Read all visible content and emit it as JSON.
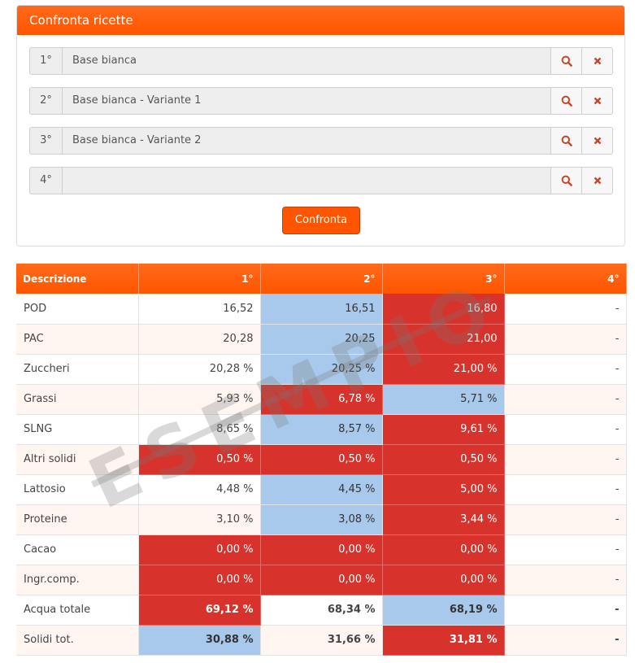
{
  "panel": {
    "title": "Confronta ricette"
  },
  "recipes": [
    {
      "ord": "1°",
      "value": "Base bianca"
    },
    {
      "ord": "2°",
      "value": "Base bianca - Variante 1"
    },
    {
      "ord": "3°",
      "value": "Base bianca - Variante 2"
    },
    {
      "ord": "4°",
      "value": ""
    }
  ],
  "icons": {
    "search": "search-icon",
    "remove": "close-icon"
  },
  "compare_button": "Confronta",
  "table": {
    "headers": [
      "Descrizione",
      "1°",
      "2°",
      "3°",
      "4°"
    ],
    "rows": [
      {
        "label": "POD",
        "c1": "16,52",
        "c2": "16,51",
        "c3": "16,80",
        "c4": "-"
      },
      {
        "label": "PAC",
        "c1": "20,28",
        "c2": "20,25",
        "c3": "21,00",
        "c4": "-"
      },
      {
        "label": "Zuccheri",
        "c1": "20,28 %",
        "c2": "20,25 %",
        "c3": "21,00 %",
        "c4": "-"
      },
      {
        "label": "Grassi",
        "c1": "5,93 %",
        "c2": "6,78 %",
        "c3": "5,71 %",
        "c4": "-"
      },
      {
        "label": "SLNG",
        "c1": "8,65 %",
        "c2": "8,57 %",
        "c3": "9,61 %",
        "c4": "-"
      },
      {
        "label": "Altri solidi",
        "c1": "0,50 %",
        "c2": "0,50 %",
        "c3": "0,50 %",
        "c4": "-"
      },
      {
        "label": "Lattosio",
        "c1": "4,48 %",
        "c2": "4,45 %",
        "c3": "5,00 %",
        "c4": "-"
      },
      {
        "label": "Proteine",
        "c1": "3,10 %",
        "c2": "3,08 %",
        "c3": "3,44 %",
        "c4": "-"
      },
      {
        "label": "Cacao",
        "c1": "0,00 %",
        "c2": "0,00 %",
        "c3": "0,00 %",
        "c4": "-"
      },
      {
        "label": "Ingr.comp.",
        "c1": "0,00 %",
        "c2": "0,00 %",
        "c3": "0,00 %",
        "c4": "-"
      },
      {
        "label": "Acqua totale",
        "c1": "69,12 %",
        "c2": "68,34 %",
        "c3": "68,19 %",
        "c4": "-"
      },
      {
        "label": "Solidi tot.",
        "c1": "30,88 %",
        "c2": "31,66 %",
        "c3": "31,81 %",
        "c4": "-"
      }
    ]
  },
  "watermark": "ESEMPIO",
  "colors": {
    "accent": "#ff5500",
    "high": "#d8322c",
    "low": "#a9c9ec"
  }
}
